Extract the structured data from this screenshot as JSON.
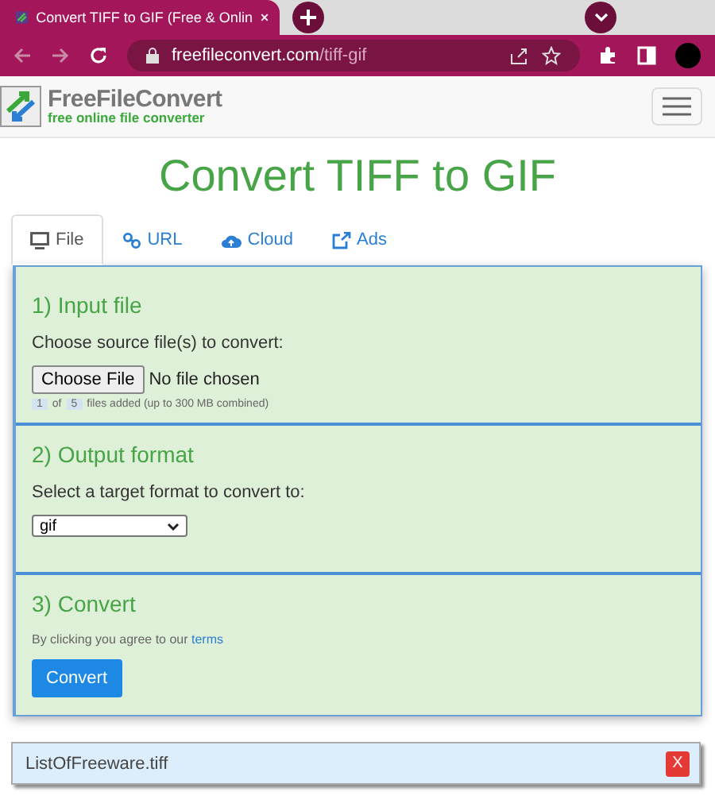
{
  "browser": {
    "tab_title": "Convert TIFF to GIF (Free & Onlin",
    "url_host": "freefileconvert.com",
    "url_path": "/tiff-gif"
  },
  "site": {
    "logo_name": "FreeFileConvert",
    "logo_tagline": "free online file converter"
  },
  "heading": "Convert TIFF to GIF",
  "tabs": [
    {
      "label": "File",
      "selected": true
    },
    {
      "label": "URL",
      "selected": false
    },
    {
      "label": "Cloud",
      "selected": false
    },
    {
      "label": "Ads",
      "selected": false
    }
  ],
  "sections": [
    {
      "kind": "input",
      "title": "1) Input file",
      "prompt": "Choose source file(s) to convert:",
      "button": "Choose File",
      "status": "No file chosen",
      "count": "1",
      "of": "of",
      "max": "5",
      "note": "files added (up to 300 MB combined)"
    },
    {
      "kind": "format",
      "title": "2) Output format",
      "prompt": "Select a target format to convert to:",
      "value": "gif"
    },
    {
      "kind": "convert",
      "title": "3) Convert",
      "text": "By clicking you agree to our",
      "link": "terms",
      "button": "Convert"
    }
  ],
  "files": [
    {
      "name": "ListOfFreeware.tiff",
      "remove": "X"
    }
  ]
}
